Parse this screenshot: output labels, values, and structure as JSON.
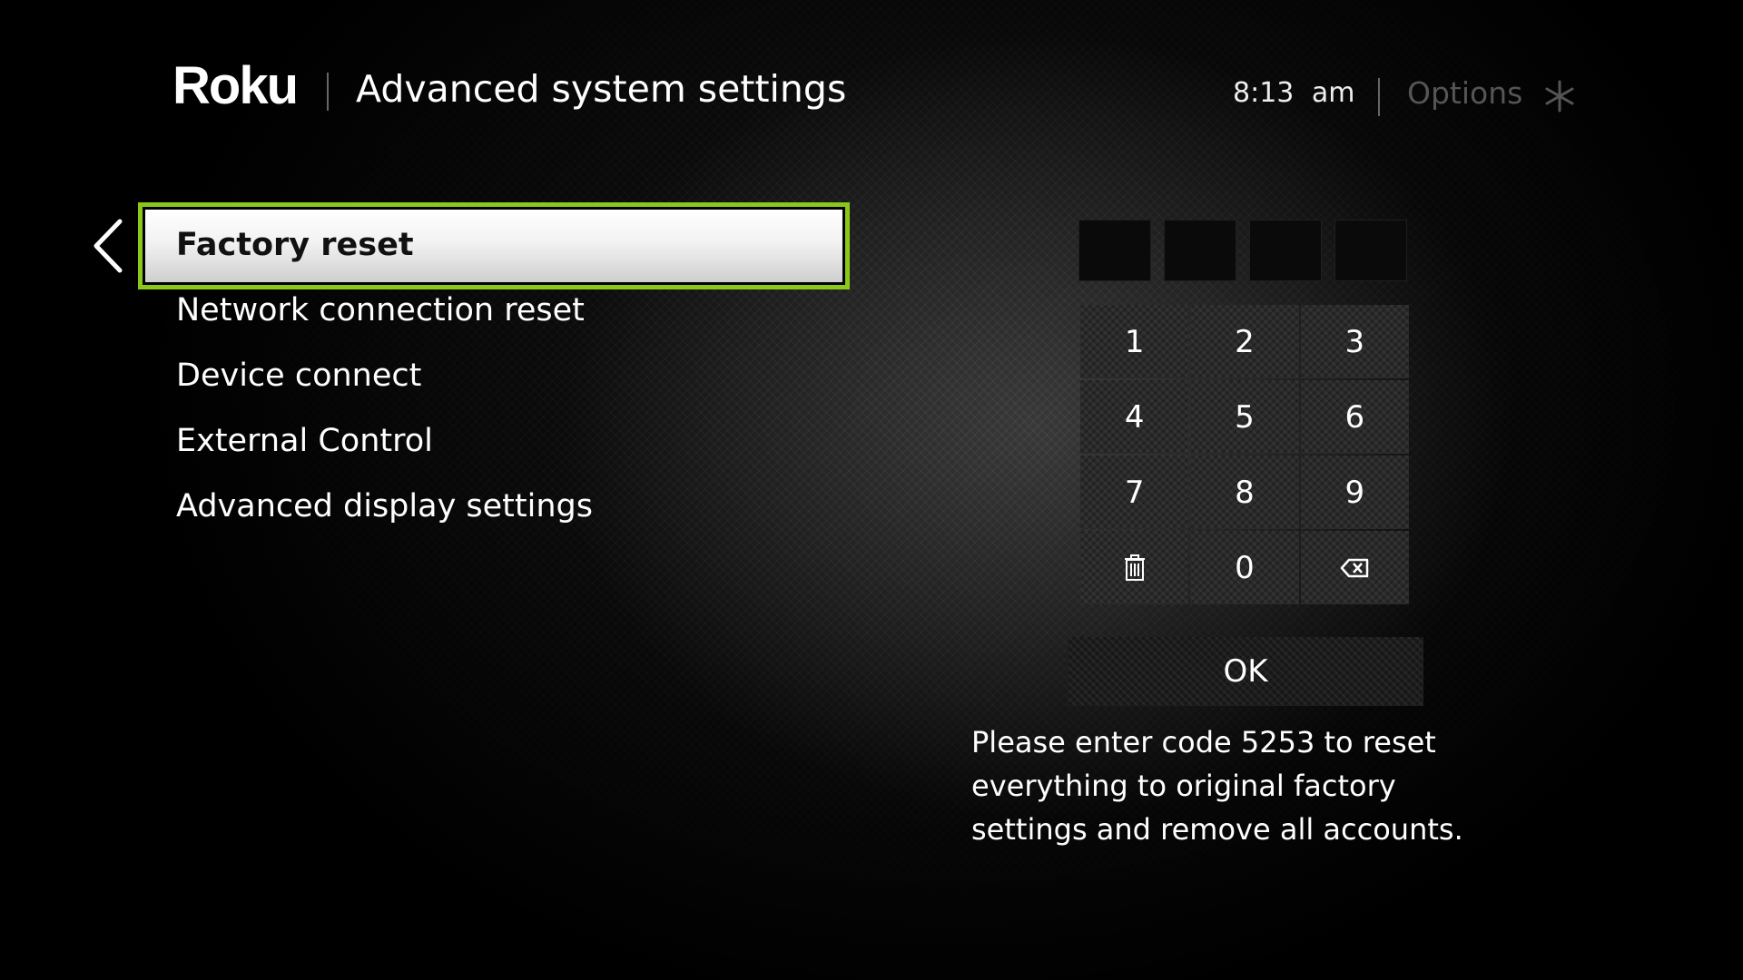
{
  "colors": {
    "accent": "#8bc81a",
    "background": "#000000",
    "text": "#ffffff",
    "muted": "#555555"
  },
  "header": {
    "logo": "Roku",
    "title": "Advanced system settings",
    "time": "8:13 am",
    "options_label": "Options",
    "options_icon": "asterisk-icon"
  },
  "menu": {
    "back_icon": "chevron-left-icon",
    "items": [
      {
        "label": "Factory reset",
        "selected": true
      },
      {
        "label": "Network connection reset",
        "selected": false
      },
      {
        "label": "Device connect",
        "selected": false
      },
      {
        "label": "External Control",
        "selected": false
      },
      {
        "label": "Advanced display settings",
        "selected": false
      }
    ]
  },
  "code_entry": {
    "digits_entered": [
      "",
      "",
      "",
      ""
    ],
    "keypad": [
      "1",
      "2",
      "3",
      "4",
      "5",
      "6",
      "7",
      "8",
      "9",
      "0"
    ],
    "clear_icon": "trash-icon",
    "backspace_icon": "backspace-icon",
    "ok_label": "OK"
  },
  "instructions": "Please enter code 5253 to reset everything to original factory settings and remove all accounts."
}
